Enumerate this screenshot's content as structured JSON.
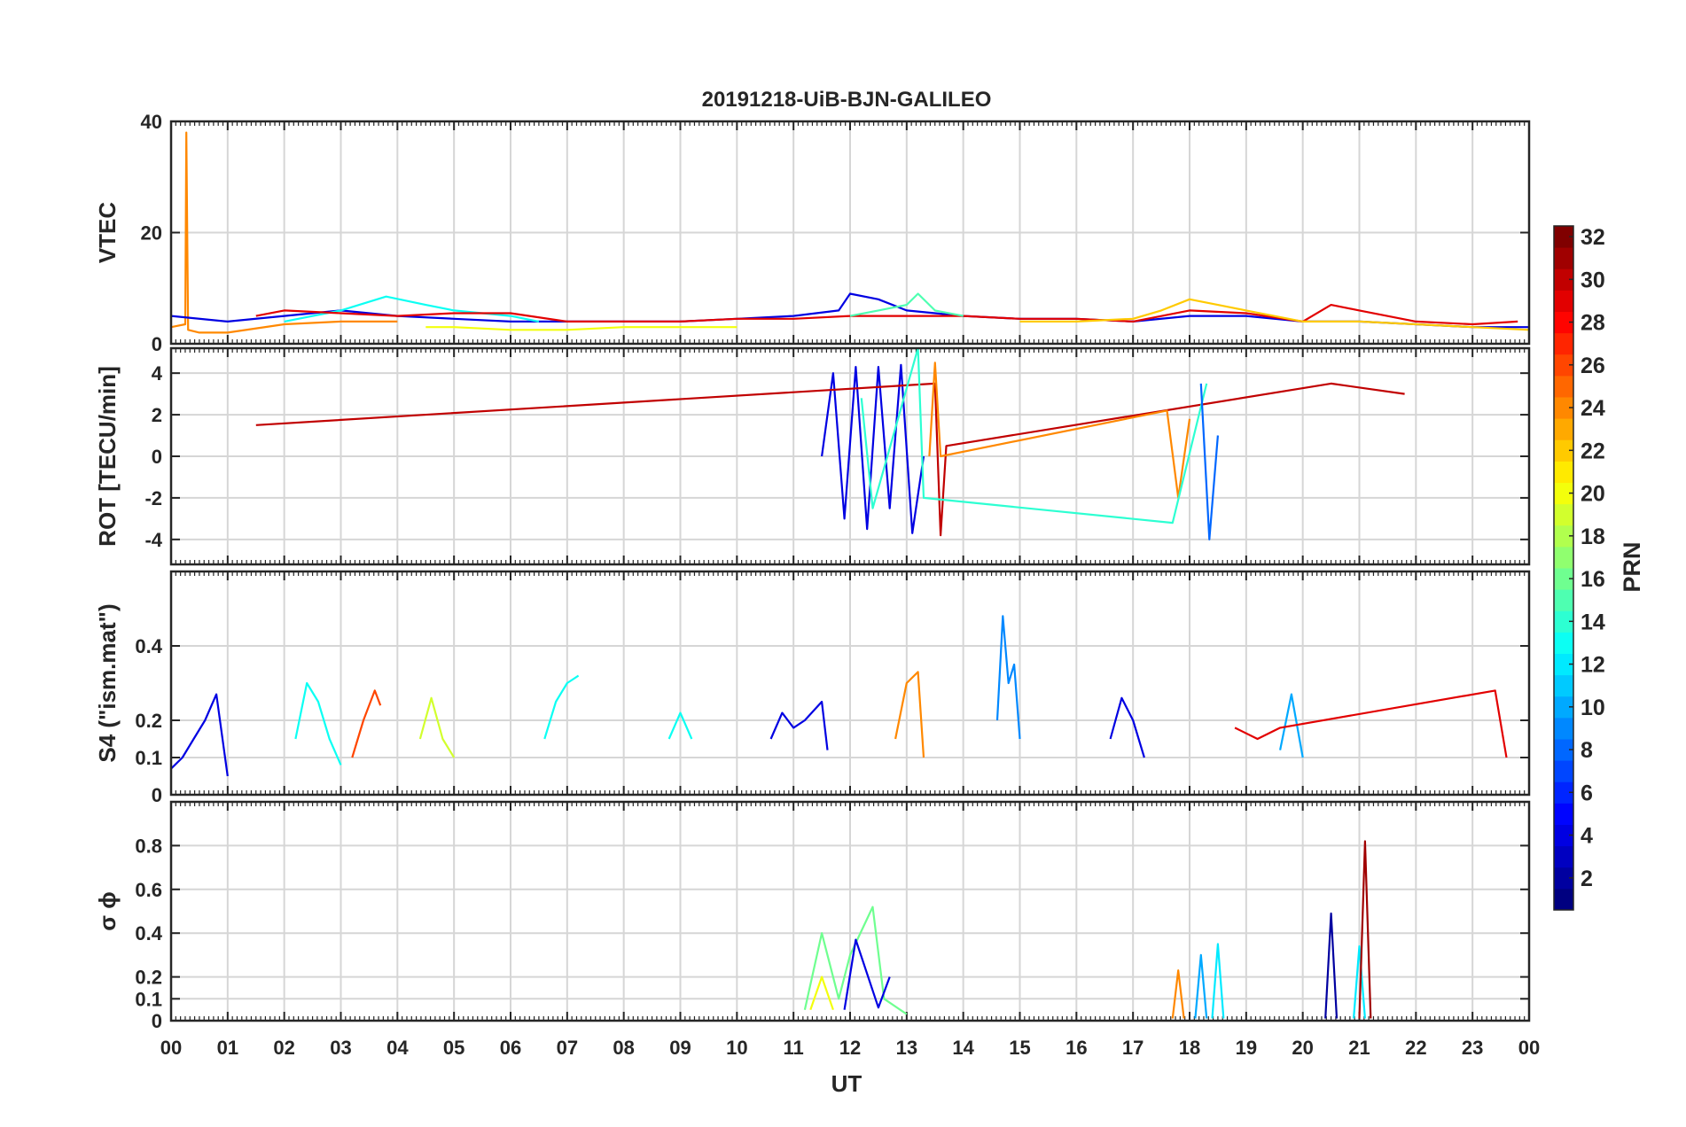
{
  "figure": {
    "title": "20191218-UiB-BJN-GALILEO",
    "xlabel": "UT",
    "xticks": [
      "00",
      "01",
      "02",
      "03",
      "04",
      "05",
      "06",
      "07",
      "08",
      "09",
      "10",
      "11",
      "12",
      "13",
      "14",
      "15",
      "16",
      "17",
      "18",
      "19",
      "20",
      "21",
      "22",
      "23",
      "00"
    ]
  },
  "colorbar": {
    "label": "PRN",
    "ticks": [
      "2",
      "4",
      "6",
      "8",
      "10",
      "12",
      "14",
      "16",
      "18",
      "20",
      "22",
      "24",
      "26",
      "28",
      "30",
      "32"
    ],
    "range": [
      1,
      32
    ],
    "colormap": "jet"
  },
  "chart_data": [
    {
      "type": "line",
      "panel": "VTEC",
      "ylabel": "VTEC",
      "ylim": [
        0,
        40
      ],
      "yticks": [
        "0",
        "20",
        "40"
      ],
      "xlim": [
        0,
        24
      ],
      "grid": true,
      "series": [
        {
          "prn": 24,
          "x": [
            0,
            0.25,
            0.27,
            0.3,
            0.5,
            1,
            2,
            3,
            4
          ],
          "y": [
            3,
            3.5,
            38,
            2.5,
            2,
            2,
            3.5,
            4,
            4
          ]
        },
        {
          "prn": 4,
          "x": [
            0,
            1,
            2,
            3,
            4,
            5,
            6,
            7,
            8,
            9,
            10,
            11,
            11.8,
            12,
            12.5,
            13,
            14,
            15,
            16,
            17,
            18,
            19,
            20,
            21,
            22,
            23,
            24
          ],
          "y": [
            5,
            4,
            5,
            6,
            5,
            4.5,
            4,
            4,
            4,
            4,
            4.5,
            5,
            6,
            9,
            8,
            6,
            5,
            4.5,
            4.5,
            4,
            5,
            5,
            4,
            4,
            3.5,
            3,
            3
          ]
        },
        {
          "prn": 13,
          "x": [
            2,
            3,
            3.8,
            4.5,
            5,
            6,
            6.5
          ],
          "y": [
            4,
            6,
            8.5,
            7,
            6,
            5,
            4
          ]
        },
        {
          "prn": 29,
          "x": [
            1.5,
            2,
            3,
            4,
            5,
            6,
            7,
            8,
            9,
            10,
            11,
            12,
            13,
            14,
            15,
            16,
            17,
            18,
            19,
            20,
            20.5,
            21,
            22,
            23,
            23.8
          ],
          "y": [
            5,
            6,
            5.5,
            5,
            5.5,
            5.5,
            4,
            4,
            4,
            4.5,
            4.5,
            5,
            5,
            5,
            4.5,
            4.5,
            4,
            6,
            5.5,
            4,
            7,
            6,
            4,
            3.5,
            4
          ]
        },
        {
          "prn": 22,
          "x": [
            15,
            16,
            17,
            17.5,
            18,
            18.5,
            19,
            20,
            21,
            22,
            23,
            24
          ],
          "y": [
            4,
            4,
            4.5,
            6,
            8,
            7,
            6,
            4,
            4,
            3.5,
            3,
            2.5
          ]
        },
        {
          "prn": 20,
          "x": [
            4.5,
            5,
            6,
            7,
            8,
            9,
            10
          ],
          "y": [
            3,
            3,
            2.5,
            2.5,
            3,
            3,
            3
          ]
        },
        {
          "prn": 15,
          "x": [
            12,
            12.5,
            13,
            13.2,
            13.5,
            14
          ],
          "y": [
            5,
            6,
            7,
            9,
            6,
            5
          ]
        }
      ]
    },
    {
      "type": "line",
      "panel": "ROT",
      "ylabel": "ROT [TECU/min]",
      "ylim": [
        -5.2,
        5.2
      ],
      "yticks": [
        "-4",
        "-2",
        "0",
        "2",
        "4"
      ],
      "xlim": [
        0,
        24
      ],
      "grid": true,
      "series": [
        {
          "prn": 4,
          "x": [
            11.5,
            11.7,
            11.9,
            12.1,
            12.3,
            12.5,
            12.7,
            12.9,
            13.1,
            13.3
          ],
          "y": [
            0,
            4,
            -3,
            4.3,
            -3.5,
            4.3,
            -2.5,
            4.4,
            -3.7,
            0
          ]
        },
        {
          "prn": 30,
          "x": [
            1.5,
            13.5,
            13.6,
            13.7,
            20.5,
            21.8
          ],
          "y": [
            1.5,
            3.5,
            -3.8,
            0.5,
            3.5,
            3
          ]
        },
        {
          "prn": 24,
          "x": [
            13.4,
            13.5,
            13.6,
            17.6,
            17.8,
            18
          ],
          "y": [
            0,
            4.5,
            0,
            2.2,
            -2,
            1.8
          ]
        },
        {
          "prn": 14,
          "x": [
            12.2,
            12.4,
            13.2,
            13.3,
            17.7,
            18.3
          ],
          "y": [
            2.8,
            -2.5,
            5.2,
            -2,
            -3.2,
            3.5
          ]
        },
        {
          "prn": 8,
          "x": [
            18.2,
            18.35,
            18.5
          ],
          "y": [
            3.5,
            -4,
            1
          ]
        }
      ]
    },
    {
      "type": "line",
      "panel": "S4",
      "ylabel": "S4 (\"ism.mat\")",
      "ylim": [
        0,
        0.6
      ],
      "yticks": [
        "0",
        "0.1",
        "0.2",
        "0.4"
      ],
      "xlim": [
        0,
        24
      ],
      "grid": true,
      "series": [
        {
          "prn": 4,
          "x": [
            0,
            0.2,
            0.4,
            0.6,
            0.8,
            1
          ],
          "y": [
            0.07,
            0.1,
            0.15,
            0.2,
            0.27,
            0.05
          ]
        },
        {
          "prn": 13,
          "x": [
            2.2,
            2.4,
            2.6,
            2.8,
            3
          ],
          "y": [
            0.15,
            0.3,
            0.25,
            0.15,
            0.08
          ]
        },
        {
          "prn": 26,
          "x": [
            3.2,
            3.4,
            3.6,
            3.7
          ],
          "y": [
            0.1,
            0.2,
            0.28,
            0.24
          ]
        },
        {
          "prn": 19,
          "x": [
            4.4,
            4.6,
            4.8,
            5
          ],
          "y": [
            0.15,
            0.26,
            0.15,
            0.1
          ]
        },
        {
          "prn": 13,
          "x": [
            6.6,
            6.8,
            7,
            7.2
          ],
          "y": [
            0.15,
            0.25,
            0.3,
            0.32
          ]
        },
        {
          "prn": 13,
          "x": [
            8.8,
            9,
            9.2
          ],
          "y": [
            0.15,
            0.22,
            0.15
          ]
        },
        {
          "prn": 4,
          "x": [
            10.6,
            10.8,
            11,
            11.2,
            11.5,
            11.6
          ],
          "y": [
            0.15,
            0.22,
            0.18,
            0.2,
            0.25,
            0.12
          ]
        },
        {
          "prn": 24,
          "x": [
            12.8,
            13,
            13.2,
            13.3
          ],
          "y": [
            0.15,
            0.3,
            0.33,
            0.1
          ]
        },
        {
          "prn": 9,
          "x": [
            14.6,
            14.7,
            14.8,
            14.9,
            15
          ],
          "y": [
            0.2,
            0.48,
            0.3,
            0.35,
            0.15
          ]
        },
        {
          "prn": 4,
          "x": [
            16.6,
            16.8,
            17,
            17.2
          ],
          "y": [
            0.15,
            0.26,
            0.2,
            0.1
          ]
        },
        {
          "prn": 10,
          "x": [
            19.6,
            19.8,
            20
          ],
          "y": [
            0.12,
            0.27,
            0.1
          ]
        },
        {
          "prn": 29,
          "x": [
            18.8,
            19.2,
            19.6,
            23.4,
            23.6
          ],
          "y": [
            0.18,
            0.15,
            0.18,
            0.28,
            0.1
          ]
        }
      ]
    },
    {
      "type": "line",
      "panel": "sigma_phi",
      "ylabel": "σ ϕ",
      "ylim": [
        0,
        1
      ],
      "yticks": [
        "0",
        "0.1",
        "0.2",
        "0.4",
        "0.6",
        "0.8"
      ],
      "xlim": [
        0,
        24
      ],
      "grid": true,
      "series": [
        {
          "prn": 16,
          "x": [
            11.2,
            11.5,
            11.8,
            12,
            12.4,
            12.6,
            13
          ],
          "y": [
            0.05,
            0.4,
            0.1,
            0.3,
            0.52,
            0.1,
            0.03
          ]
        },
        {
          "prn": 4,
          "x": [
            11.9,
            12.1,
            12.5,
            12.7
          ],
          "y": [
            0.05,
            0.37,
            0.06,
            0.2
          ]
        },
        {
          "prn": 20,
          "x": [
            11.3,
            11.5,
            11.7
          ],
          "y": [
            0.05,
            0.2,
            0.05
          ]
        },
        {
          "prn": 24,
          "x": [
            17.7,
            17.8,
            17.9
          ],
          "y": [
            0.01,
            0.23,
            0.01
          ]
        },
        {
          "prn": 10,
          "x": [
            18.1,
            18.2,
            18.3
          ],
          "y": [
            0.01,
            0.3,
            0.01
          ]
        },
        {
          "prn": 12,
          "x": [
            18.4,
            18.5,
            18.6
          ],
          "y": [
            0.01,
            0.35,
            0.01
          ]
        },
        {
          "prn": 2,
          "x": [
            20.4,
            20.5,
            20.6
          ],
          "y": [
            0.01,
            0.49,
            0.01
          ]
        },
        {
          "prn": 12,
          "x": [
            20.9,
            21,
            21.1
          ],
          "y": [
            0.01,
            0.34,
            0.01
          ]
        },
        {
          "prn": 31,
          "x": [
            21.0,
            21.1,
            21.2
          ],
          "y": [
            0.01,
            0.82,
            0.01
          ]
        }
      ]
    }
  ]
}
